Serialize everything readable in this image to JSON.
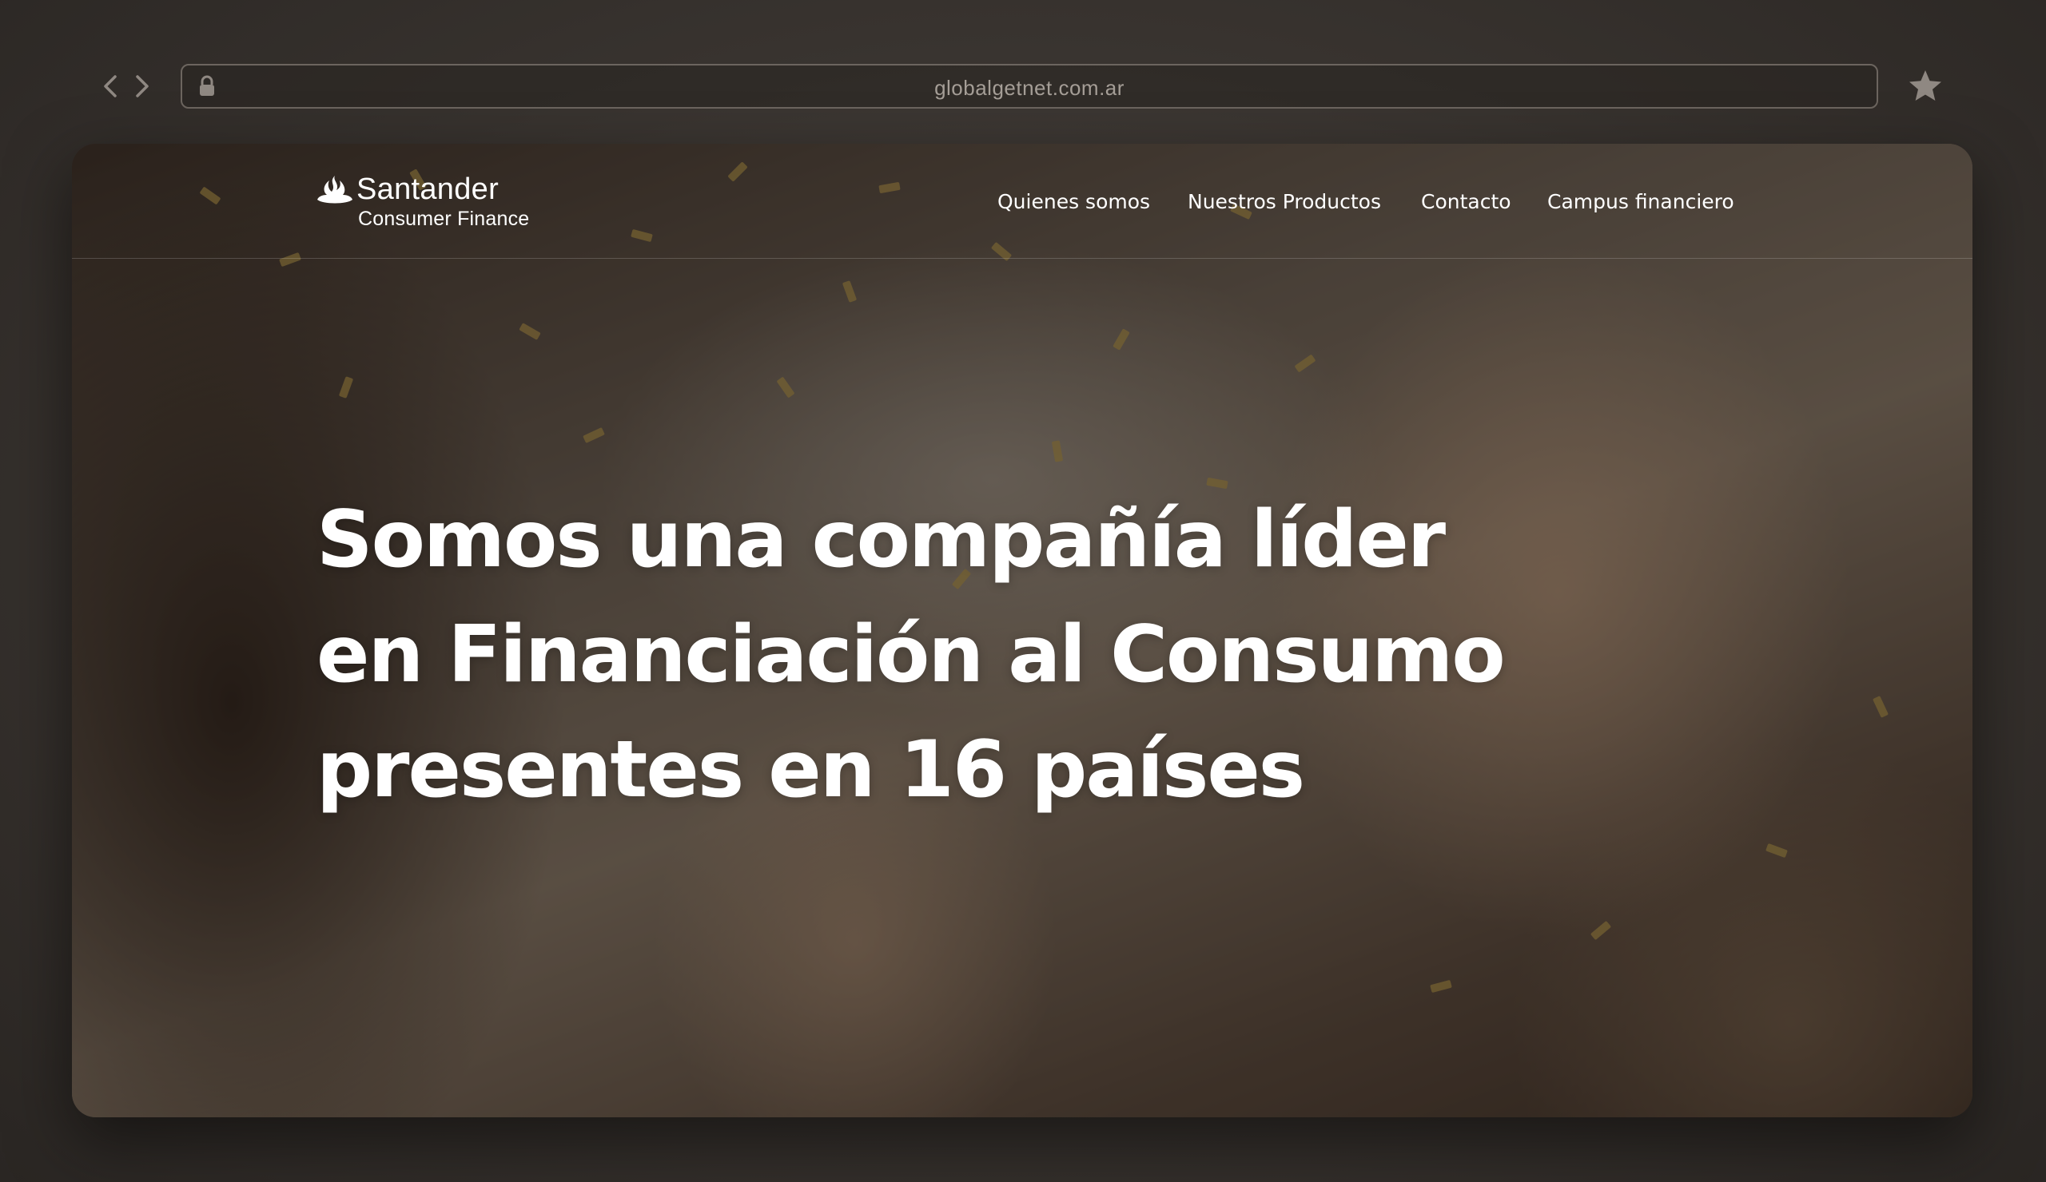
{
  "browser": {
    "url": "globalgetnet.com.ar"
  },
  "site": {
    "brand": {
      "name": "Santander",
      "subtitle": "Consumer Finance"
    },
    "nav": [
      {
        "label": "Quienes somos"
      },
      {
        "label": "Nuestros Productos"
      },
      {
        "label": "Contacto"
      },
      {
        "label": "Campus financiero"
      }
    ],
    "hero": {
      "lines": [
        "Somos una compañía líder",
        "en Financiación al Consumo",
        "presentes en 16 países"
      ]
    }
  },
  "colors": {
    "text": "#ffffff",
    "page_background": "#38332f",
    "address_bar_border": "#6c655f"
  },
  "icons": [
    "back-arrow-icon",
    "forward-arrow-icon",
    "lock-icon",
    "star-icon",
    "santander-flame-icon"
  ]
}
